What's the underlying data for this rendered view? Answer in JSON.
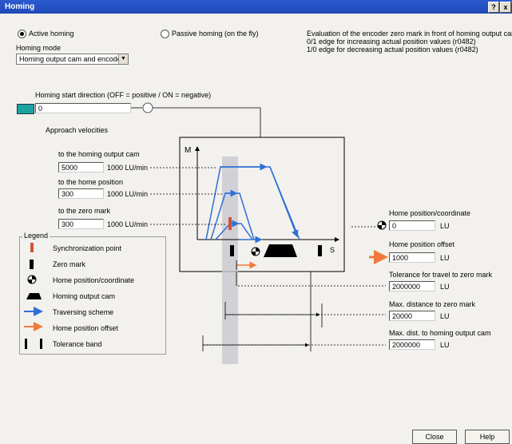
{
  "window": {
    "title": "Homing",
    "help_button": "?",
    "close_button": "x"
  },
  "mode": {
    "active_homing": "Active homing",
    "passive_homing": "Passive homing (on the fly)",
    "homing_mode_label": "Homing mode",
    "homing_mode_value": "Homing output cam and encode"
  },
  "evaluation": {
    "line1": "Evaluation of the encoder zero mark in front of homing output cam",
    "line2": "0/1 edge for increasing actual position values (r0482)",
    "line3": "1/0 edge for decreasing actual position values (r0482)"
  },
  "start_direction": {
    "label": "Homing start direction (OFF = positive / ON = negative)",
    "value": "0"
  },
  "velocities": {
    "heading": "Approach velocities",
    "cam_label": "to the homing output cam",
    "cam_value": "5000",
    "home_label": "to the home position",
    "home_value": "300",
    "zero_label": "to the zero mark",
    "zero_value": "300",
    "unit": "1000 LU/min"
  },
  "diagram": {
    "m_axis": "M",
    "s_axis": "S"
  },
  "legend": {
    "title": "Legend",
    "items": [
      "Synchronization point",
      "Zero mark",
      "Home position/coordinate",
      "Homing output cam",
      "Traversing scheme",
      "Home position offset",
      "Tolerance band"
    ]
  },
  "parameters": {
    "home_coord_label": "Home position/coordinate",
    "home_coord_value": "0",
    "home_coord_unit": "LU",
    "offset_label": "Home position offset",
    "offset_value": "1000",
    "offset_unit": "LU",
    "tolerance_label": "Tolerance for travel to zero mark",
    "tolerance_value": "2000000",
    "tolerance_unit": "LU",
    "max_zero_label": "Max. distance to zero mark",
    "max_zero_value": "20000",
    "max_zero_unit": "LU",
    "max_cam_label": "Max. dist. to homing output cam",
    "max_cam_value": "2000000",
    "max_cam_unit": "LU"
  },
  "buttons": {
    "close": "Close",
    "help": "Help"
  },
  "colors": {
    "titlebar": "#1f49b5",
    "arrow_blue": "#2f6fd6",
    "arrow_orange": "#f07a3a",
    "sync_red": "#d2533a"
  }
}
